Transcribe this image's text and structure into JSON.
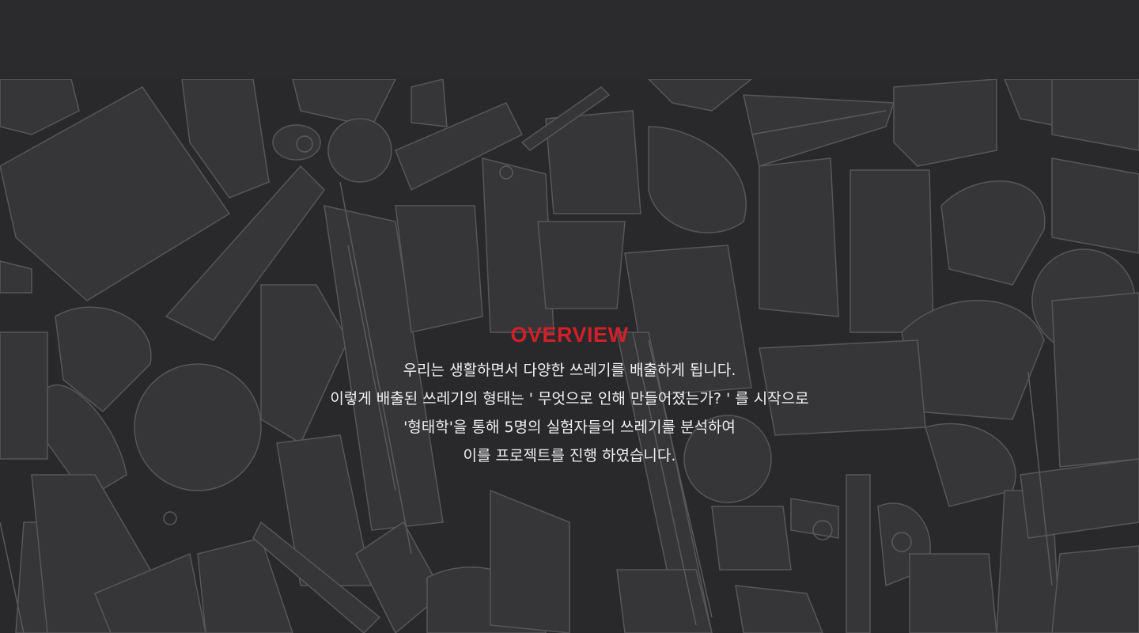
{
  "colors": {
    "page_background": "#2a292b",
    "top_bar": "#2b2a2c",
    "accent": "#d0202a",
    "body_text": "#f2f2f2",
    "illustration_fill": "#3b3a3c",
    "illustration_stroke": "#5a595b"
  },
  "overview": {
    "title": "OVERVIEW",
    "lines": [
      "우리는 생활하면서 다양한 쓰레기를 배출하게 됩니다.",
      "이렇게 배출된 쓰레기의 형태는 ' 무엇으로 인해 만들어졌는가? ' 를 시작으로",
      "'형태학'을 통해 5명의 실험자들의 쓰레기를 분석하여",
      "이를 프로젝트를 진행 하였습니다."
    ]
  },
  "background": {
    "illustration": "trash-objects-pattern"
  }
}
